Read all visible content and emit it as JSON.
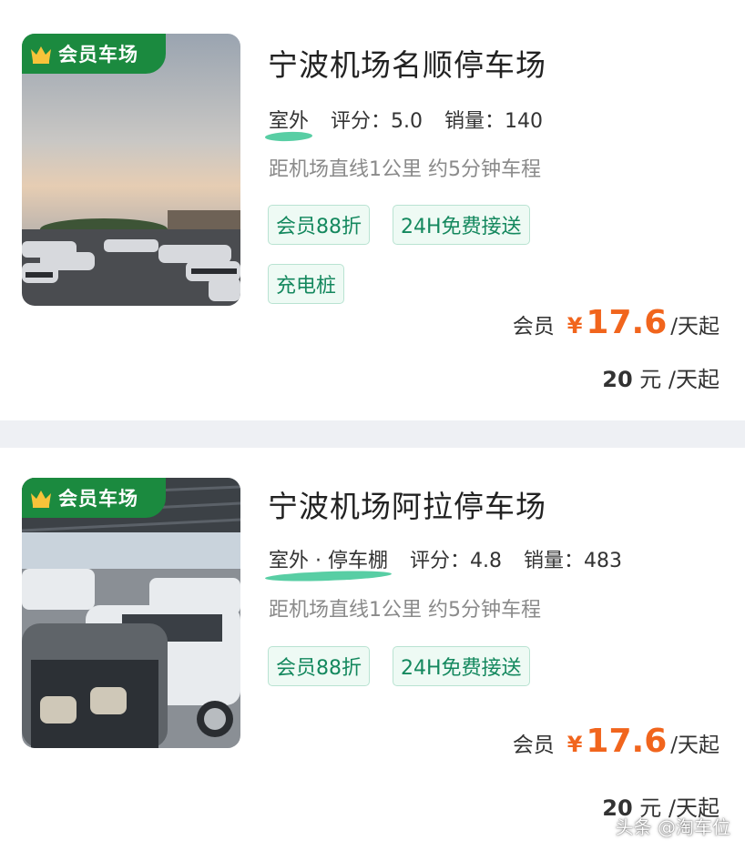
{
  "listings": [
    {
      "badge": "会员车场",
      "name": "宁波机场名顺停车场",
      "type": "室外",
      "rating_label": "评分：",
      "rating": "5.0",
      "sales_label": "销量：",
      "sales": "140",
      "distance": "距机场直线1公里 约5分钟车程",
      "tags": [
        "会员88折",
        "24H免费接送",
        "充电桩"
      ],
      "member_label": "会员",
      "currency": "¥",
      "member_price": "17.6",
      "per_day": "/天起",
      "orig_price": "20",
      "orig_unit": " 元 /天起"
    },
    {
      "badge": "会员车场",
      "name": "宁波机场阿拉停车场",
      "type": "室外 · 停车棚",
      "rating_label": "评分：",
      "rating": "4.8",
      "sales_label": "销量：",
      "sales": "483",
      "distance": "距机场直线1公里 约5分钟车程",
      "tags": [
        "会员88折",
        "24H免费接送"
      ],
      "member_label": "会员",
      "currency": "¥",
      "member_price": "17.6",
      "per_day": "/天起",
      "orig_price": "20",
      "orig_unit": " 元 /天起"
    }
  ],
  "watermark": "头条 @淘车位",
  "colors": {
    "accent_orange": "#f1651d",
    "badge_green": "#1b8a3f",
    "tag_text": "#14885e",
    "tag_bg": "#eefaf4"
  }
}
